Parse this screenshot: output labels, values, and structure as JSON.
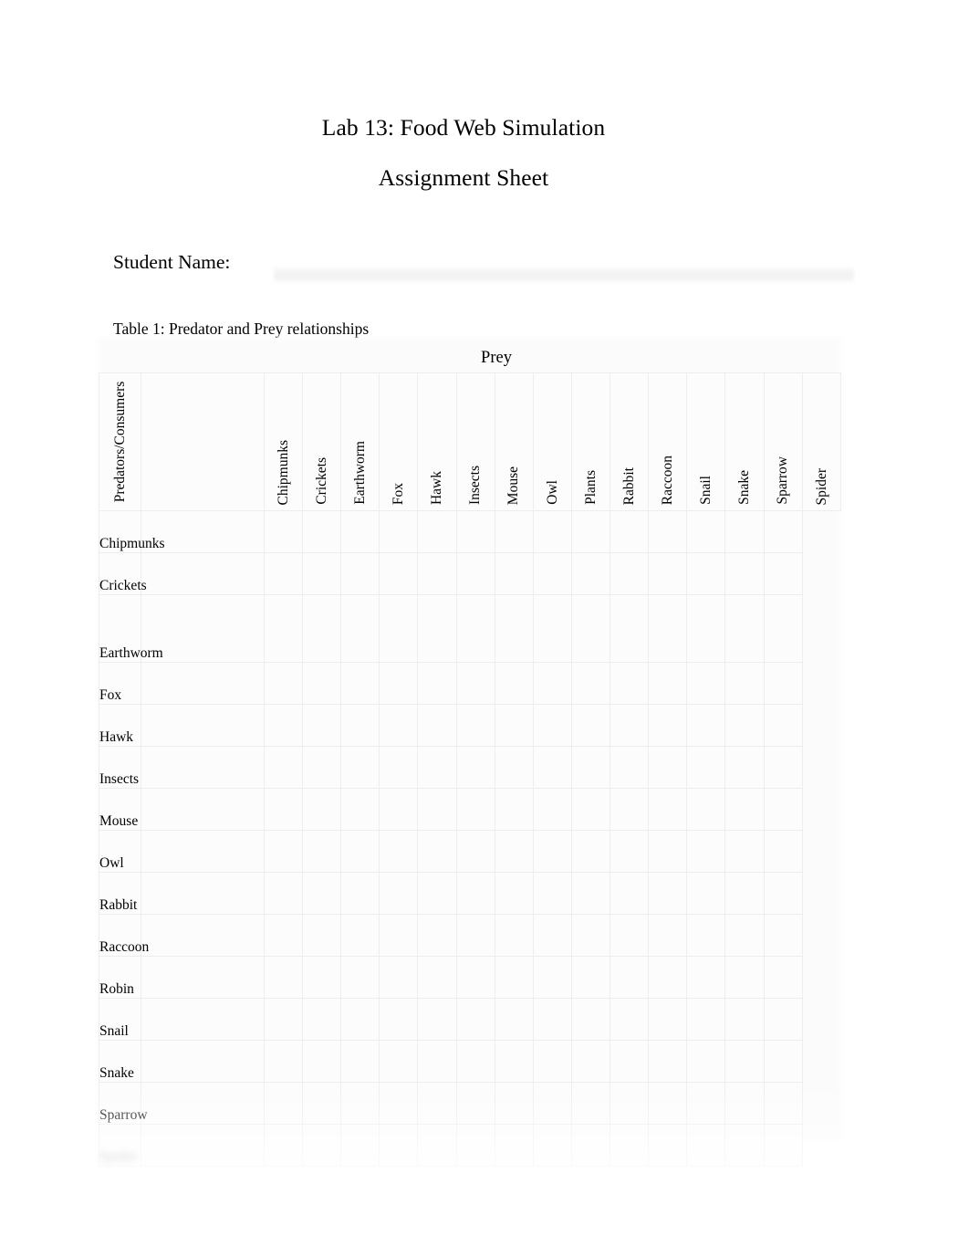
{
  "document": {
    "title_line_1": "Lab 13: Food Web Simulation",
    "title_line_2": "Assignment Sheet"
  },
  "student": {
    "label": "Student Name:",
    "value": "",
    "placeholder": ""
  },
  "table": {
    "caption": "Table 1: Predator and Prey relationships",
    "column_axis_label": "Prey",
    "row_axis_label": "Predators/Consumers",
    "columns": [
      "Chipmunks",
      "Crickets",
      "Earthworm",
      "Fox",
      "Hawk",
      "Insects",
      "Mouse",
      "Owl",
      "Plants",
      "Rabbit",
      "Raccoon",
      "Snail",
      "Snake",
      "Sparrow",
      "Spider"
    ],
    "rows": [
      {
        "label": "Chipmunks",
        "tall": false,
        "redacted": false
      },
      {
        "label": "Crickets",
        "tall": false,
        "redacted": false
      },
      {
        "label": "Earthworm",
        "tall": true,
        "redacted": false
      },
      {
        "label": "Fox",
        "tall": false,
        "redacted": false
      },
      {
        "label": "Hawk",
        "tall": false,
        "redacted": false
      },
      {
        "label": "Insects",
        "tall": false,
        "redacted": false
      },
      {
        "label": "Mouse",
        "tall": false,
        "redacted": false
      },
      {
        "label": "Owl",
        "tall": false,
        "redacted": false
      },
      {
        "label": "Rabbit",
        "tall": false,
        "redacted": false
      },
      {
        "label": "Raccoon",
        "tall": false,
        "redacted": false
      },
      {
        "label": "Robin",
        "tall": false,
        "redacted": false
      },
      {
        "label": "Snail",
        "tall": false,
        "redacted": false
      },
      {
        "label": "Snake",
        "tall": false,
        "redacted": false
      },
      {
        "label": "Sparrow",
        "tall": false,
        "redacted": false
      },
      {
        "label": "Spider",
        "tall": false,
        "redacted": true
      }
    ],
    "cells": [
      [
        "",
        "",
        "",
        "",
        "",
        "",
        "",
        "",
        "",
        "",
        "",
        "",
        "",
        "",
        ""
      ],
      [
        "",
        "",
        "",
        "",
        "",
        "",
        "",
        "",
        "",
        "",
        "",
        "",
        "",
        "",
        ""
      ],
      [
        "",
        "",
        "",
        "",
        "",
        "",
        "",
        "",
        "",
        "",
        "",
        "",
        "",
        "",
        ""
      ],
      [
        "",
        "",
        "",
        "",
        "",
        "",
        "",
        "",
        "",
        "",
        "",
        "",
        "",
        "",
        ""
      ],
      [
        "",
        "",
        "",
        "",
        "",
        "",
        "",
        "",
        "",
        "",
        "",
        "",
        "",
        "",
        ""
      ],
      [
        "",
        "",
        "",
        "",
        "",
        "",
        "",
        "",
        "",
        "",
        "",
        "",
        "",
        "",
        ""
      ],
      [
        "",
        "",
        "",
        "",
        "",
        "",
        "",
        "",
        "",
        "",
        "",
        "",
        "",
        "",
        ""
      ],
      [
        "",
        "",
        "",
        "",
        "",
        "",
        "",
        "",
        "",
        "",
        "",
        "",
        "",
        "",
        ""
      ],
      [
        "",
        "",
        "",
        "",
        "",
        "",
        "",
        "",
        "",
        "",
        "",
        "",
        "",
        "",
        ""
      ],
      [
        "",
        "",
        "",
        "",
        "",
        "",
        "",
        "",
        "",
        "",
        "",
        "",
        "",
        "",
        ""
      ],
      [
        "",
        "",
        "",
        "",
        "",
        "",
        "",
        "",
        "",
        "",
        "",
        "",
        "",
        "",
        ""
      ],
      [
        "",
        "",
        "",
        "",
        "",
        "",
        "",
        "",
        "",
        "",
        "",
        "",
        "",
        "",
        ""
      ],
      [
        "",
        "",
        "",
        "",
        "",
        "",
        "",
        "",
        "",
        "",
        "",
        "",
        "",
        "",
        ""
      ],
      [
        "",
        "",
        "",
        "",
        "",
        "",
        "",
        "",
        "",
        "",
        "",
        "",
        "",
        "",
        ""
      ],
      [
        "",
        "",
        "",
        "",
        "",
        "",
        "",
        "",
        "",
        "",
        "",
        "",
        "",
        "",
        ""
      ]
    ]
  }
}
